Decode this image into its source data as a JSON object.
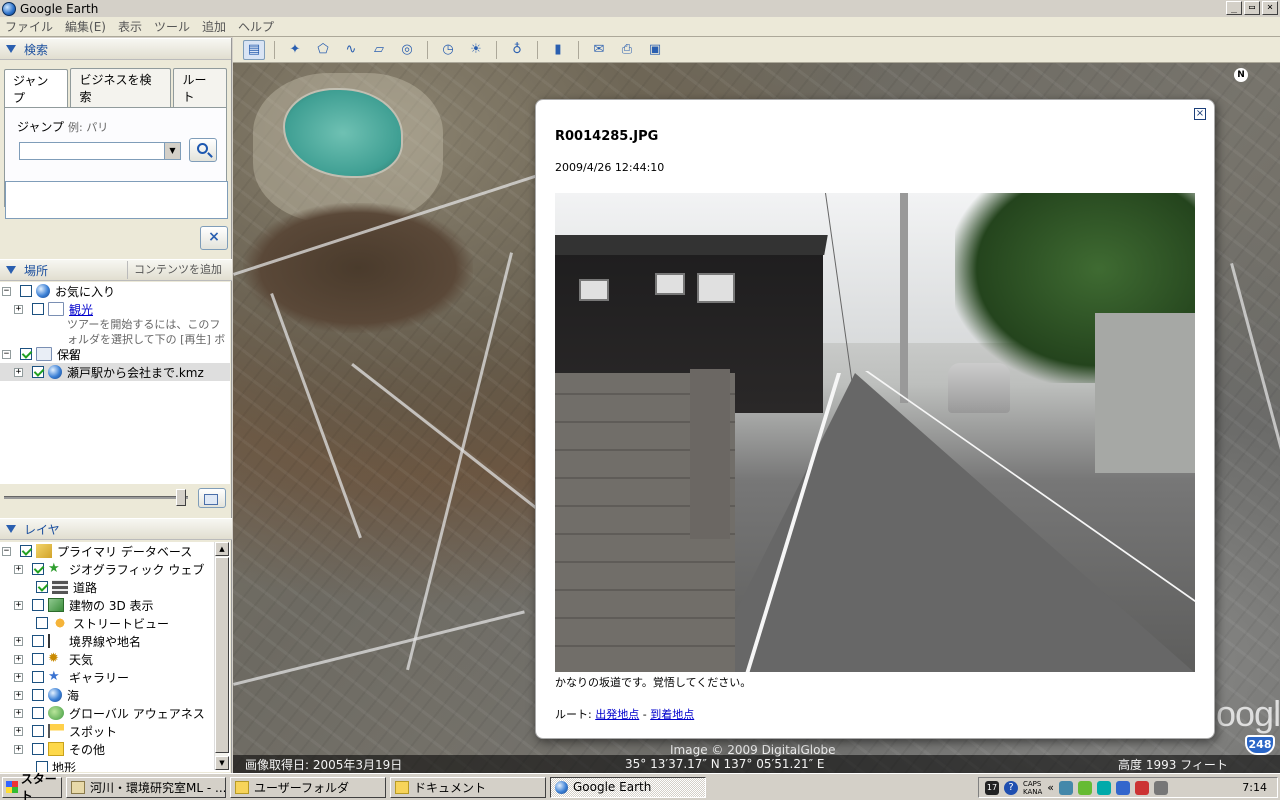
{
  "window": {
    "title": "Google Earth",
    "min": "_",
    "max": "▭",
    "close": "×"
  },
  "menu": [
    "ファイル",
    "編集(E)",
    "表示",
    "ツール",
    "追加",
    "ヘルプ"
  ],
  "search": {
    "header": "検索",
    "tabs": [
      "ジャンプ",
      "ビジネスを検索",
      "ルート"
    ],
    "jump_label": "ジャンプ",
    "jump_example": "例: パリ",
    "input_value": ""
  },
  "places": {
    "header": "場所",
    "add_content": "コンテンツを追加",
    "items": [
      {
        "label": "お気に入り"
      },
      {
        "label": "観光",
        "desc": "ツアーを開始するには、このフォルダを選択して下の [再生] ボタ"
      },
      {
        "label": "保留"
      },
      {
        "label": "瀬戸駅から会社まで.kmz"
      }
    ]
  },
  "layers": {
    "header": "レイヤ",
    "items": [
      {
        "label": "プライマリ データベース"
      },
      {
        "label": "ジオグラフィック ウェブ"
      },
      {
        "label": "道路"
      },
      {
        "label": "建物の 3D 表示"
      },
      {
        "label": "ストリートビュー"
      },
      {
        "label": "境界線や地名"
      },
      {
        "label": "天気"
      },
      {
        "label": "ギャラリー"
      },
      {
        "label": "海"
      },
      {
        "label": "グローバル アウェアネス"
      },
      {
        "label": "スポット"
      },
      {
        "label": "その他"
      },
      {
        "label": "地形"
      }
    ]
  },
  "balloon": {
    "title": "R0014285.JPG",
    "date": "2009/4/26 12:44:10",
    "caption": "かなりの坂道です。覚悟してください。",
    "route_label": "ルート:",
    "route_from": "出発地点",
    "route_sep": "-",
    "route_to": "到着地点"
  },
  "map": {
    "north": "N",
    "logo": "Google",
    "shield": "248",
    "image_date": "画像取得日: 2005年3月19日",
    "copyright": "Image © 2009 DigitalGlobe",
    "coords": "35° 13′37.17″ N   137° 05′51.21″ E",
    "altitude": "高度     1993 フィート"
  },
  "taskbar": {
    "start": "スタート",
    "tasks": [
      "河川・環境研究室ML - ...",
      "ユーザーフォルダ",
      "ドキュメント",
      "Google Earth"
    ],
    "tray_badge": "17",
    "tray_help": "?",
    "caps": "CAPS",
    "kana": "KANA",
    "tray_arrows": "«",
    "clock": "7:14"
  }
}
